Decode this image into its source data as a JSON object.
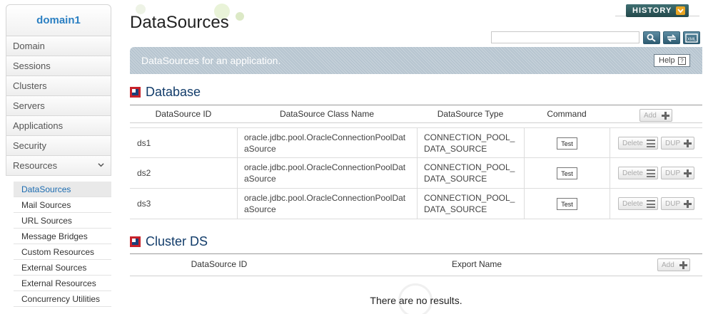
{
  "sidebar": {
    "domain": "domain1",
    "nav": [
      "Domain",
      "Sessions",
      "Clusters",
      "Servers",
      "Applications",
      "Security",
      "Resources"
    ],
    "sub": [
      "DataSources",
      "Mail Sources",
      "URL Sources",
      "Message Bridges",
      "Custom Resources",
      "External Sources",
      "External Resources",
      "Concurrency Utilities"
    ],
    "active_sub": "DataSources"
  },
  "page": {
    "title": "DataSources",
    "history_label": "HISTORY",
    "banner_text": "DataSources for an application.",
    "help_label": "Help",
    "help_q": "?"
  },
  "search": {
    "value": "",
    "placeholder": ""
  },
  "database": {
    "title": "Database",
    "headers": [
      "DataSource ID",
      "DataSource Class Name",
      "DataSource Type",
      "Command"
    ],
    "add_label": "Add",
    "rows": [
      {
        "id": "ds1",
        "class_name": "oracle.jdbc.pool.OracleConnectionPoolDataSource",
        "type": "CONNECTION_POOL_DATA_SOURCE",
        "test_label": "Test",
        "delete_label": "Delete",
        "dup_label": "DUP"
      },
      {
        "id": "ds2",
        "class_name": "oracle.jdbc.pool.OracleConnectionPoolDataSource",
        "type": "CONNECTION_POOL_DATA_SOURCE",
        "test_label": "Test",
        "delete_label": "Delete",
        "dup_label": "DUP"
      },
      {
        "id": "ds3",
        "class_name": "oracle.jdbc.pool.OracleConnectionPoolDataSource",
        "type": "CONNECTION_POOL_DATA_SOURCE",
        "test_label": "Test",
        "delete_label": "Delete",
        "dup_label": "DUP"
      }
    ]
  },
  "cluster_ds": {
    "title": "Cluster DS",
    "headers": [
      "DataSource ID",
      "Export Name"
    ],
    "add_label": "Add",
    "empty_text": "There are no results."
  },
  "colors": {
    "accent": "#2a7fc2",
    "banner": "#b7c5d0",
    "section_title": "#123c6a",
    "history": "#2f5a5d"
  },
  "icons": [
    "search-icon",
    "refresh-icon",
    "xml-export-icon",
    "chevron-down-icon",
    "plus-icon",
    "stack-icon"
  ]
}
